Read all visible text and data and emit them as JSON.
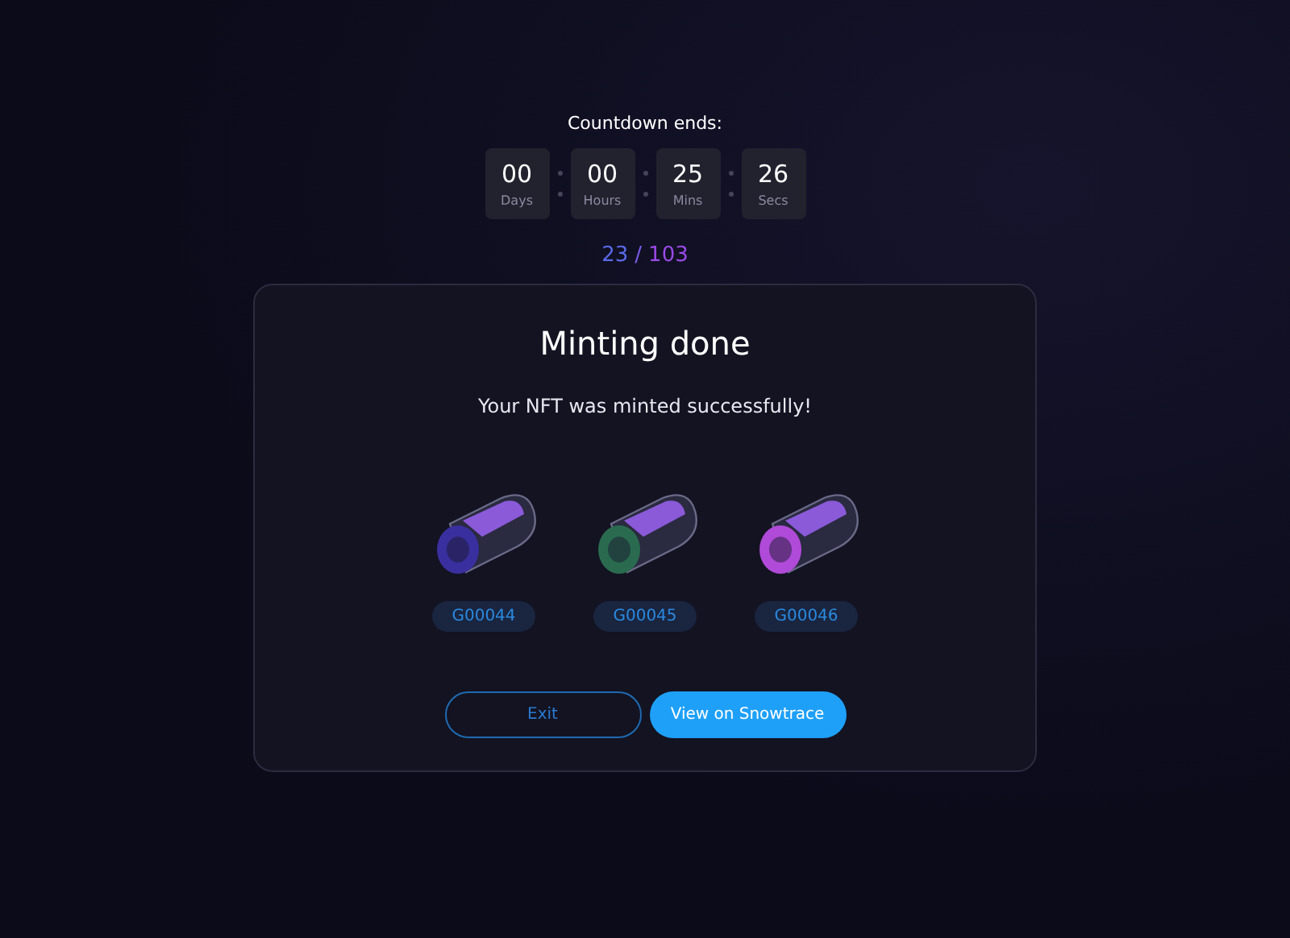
{
  "countdown": {
    "title": "Countdown ends:",
    "units": [
      {
        "value": "00",
        "label": "Days"
      },
      {
        "value": "00",
        "label": "Hours"
      },
      {
        "value": "25",
        "label": "Mins"
      },
      {
        "value": "26",
        "label": "Secs"
      }
    ]
  },
  "progress": {
    "minted": "23",
    "separator": "/",
    "total": "103"
  },
  "dialog": {
    "title": "Minting done",
    "message": "Your NFT was minted successfully!",
    "nfts": [
      {
        "id": "G00044",
        "color": "#3a2f9e"
      },
      {
        "id": "G00045",
        "color": "#2a6b4f"
      },
      {
        "id": "G00046",
        "color": "#b04ad8"
      }
    ],
    "buttons": [
      {
        "label": "Exit",
        "kind": "outline"
      },
      {
        "label": "View on Snowtrace",
        "kind": "primary"
      }
    ]
  }
}
